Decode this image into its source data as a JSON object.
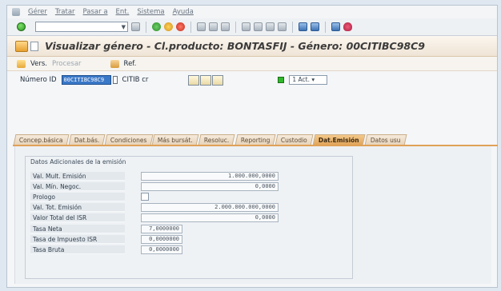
{
  "menu": {
    "items": [
      "Gérer",
      "Tratar",
      "Pasar a",
      "Ent.",
      "Sistema",
      "Ayuda"
    ]
  },
  "title": "Visualizar género - Cl.producto: BONTASFIJ - Género: 00CITIBC98C9",
  "app_toolbar": {
    "vers_label": "Vers.",
    "procesar_label": "Procesar",
    "ref_label": "Ref."
  },
  "header": {
    "numero_label": "Número ID",
    "numero_value": "00CITIBC98C9",
    "issuer_text": "CITIB cr",
    "status_value": "1 Act."
  },
  "tabs": [
    {
      "label": "Concep.básica"
    },
    {
      "label": "Dat.bás."
    },
    {
      "label": "Condiciones"
    },
    {
      "label": "Más bursát."
    },
    {
      "label": "Resoluc."
    },
    {
      "label": "Reporting"
    },
    {
      "label": "Custodio"
    },
    {
      "label": "Dat.Emisión"
    },
    {
      "label": "Datos usu"
    }
  ],
  "active_tab": "Dat.Emisión",
  "group": {
    "title": "Datos Adicionales de la emisión",
    "rows": [
      {
        "label": "Val. Mult. Emisión",
        "value": "1.000.000,0000"
      },
      {
        "label": "Val. Mín. Negoc.",
        "value": "0,0000"
      },
      {
        "label": "Prologo",
        "value": ""
      },
      {
        "label": "Val. Tot. Emisión",
        "value": "2.000.000.000,0000"
      },
      {
        "label": "Valor Total del ISR",
        "value": "0,0000"
      },
      {
        "label": "Tasa Neta",
        "value": "7,0000000"
      },
      {
        "label": "Tasa de Impuesto ISR",
        "value": "0,0000000"
      },
      {
        "label": "Tasa Bruta",
        "value": "0,0000000"
      }
    ]
  },
  "colors": {
    "accent_tab": "#e0a157",
    "title_bg": "#f3ebe0",
    "selection": "#3a78c8"
  }
}
